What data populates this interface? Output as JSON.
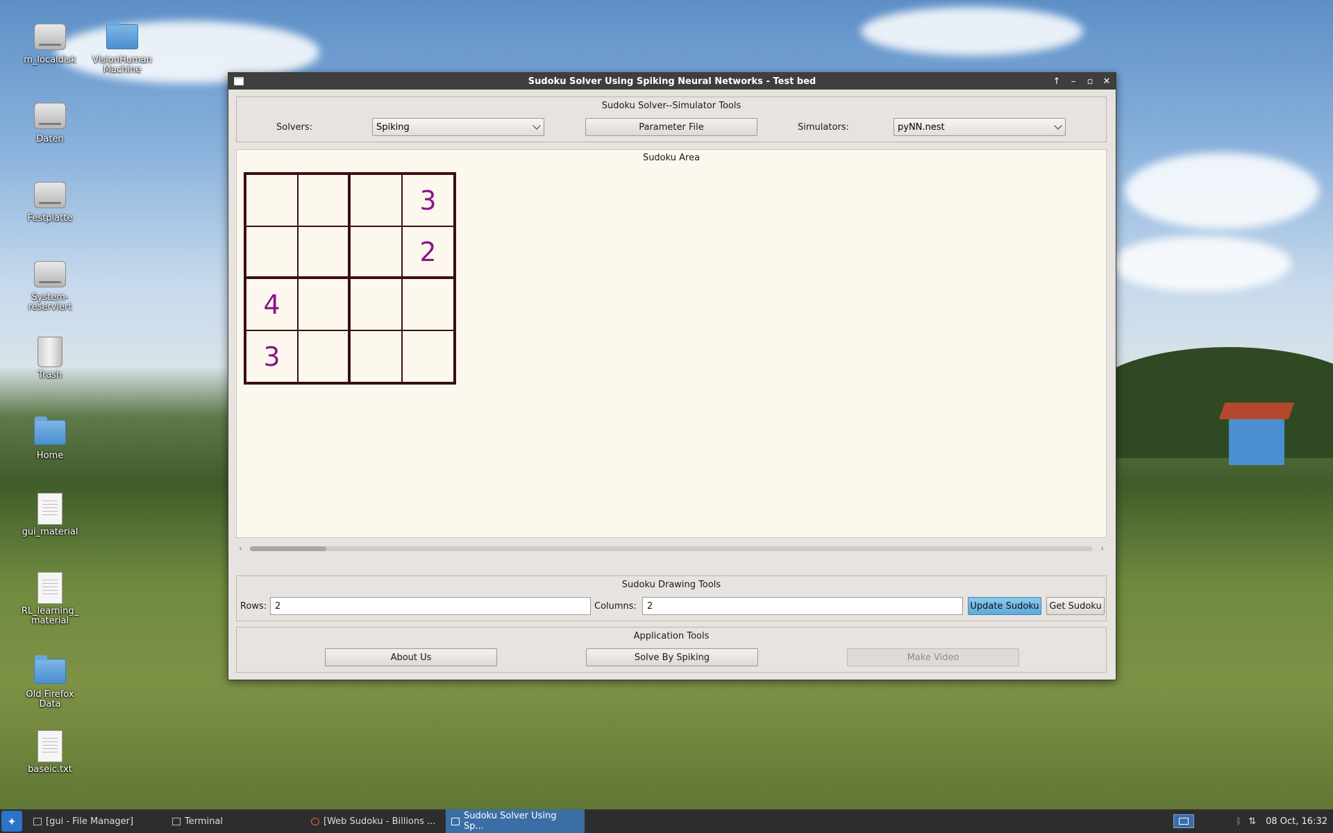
{
  "desktop": {
    "icons": [
      {
        "label": "m_localdisk",
        "icon": "drive-icon"
      },
      {
        "label": "VisionHuman\nMachine",
        "icon": "locked-folder-icon"
      },
      {
        "label": "Daten",
        "icon": "drive-icon"
      },
      {
        "label": "Festplatte",
        "icon": "drive-icon"
      },
      {
        "label": "System-\nreserviert",
        "icon": "drive-icon"
      },
      {
        "label": "Trash",
        "icon": "trash-icon"
      },
      {
        "label": "Home",
        "icon": "home-folder-icon"
      },
      {
        "label": "gui_material",
        "icon": "document-icon"
      },
      {
        "label": "RL_learning_\nmaterial",
        "icon": "document-icon"
      },
      {
        "label": "Old Firefox\nData",
        "icon": "folder-icon"
      },
      {
        "label": "baseic.txt",
        "icon": "document-icon"
      }
    ]
  },
  "window": {
    "title": "Sudoku Solver Using Spiking Neural Networks - Test bed",
    "controls": [
      "↑",
      "–",
      "▫",
      "✕"
    ],
    "simulator_tools": {
      "title": "Sudoku Solver--Simulator Tools",
      "solvers_label": "Solvers:",
      "solver_value": "Spiking",
      "parameter_button": "Parameter File",
      "simulators_label": "Simulators:",
      "simulator_value": "pyNN.nest"
    },
    "sudoku_area": {
      "title": "Sudoku Area",
      "grid": [
        [
          "",
          "",
          "",
          "3"
        ],
        [
          "",
          "",
          "",
          "2"
        ],
        [
          "4",
          "",
          "",
          ""
        ],
        [
          "3",
          "",
          "",
          ""
        ]
      ]
    },
    "drawing_tools": {
      "title": "Sudoku Drawing Tools",
      "rows_label": "Rows:",
      "rows_value": "2",
      "columns_label": "Columns:",
      "columns_value": "2",
      "update_button": "Update Sudoku",
      "get_button": "Get Sudoku"
    },
    "application_tools": {
      "title": "Application Tools",
      "about_button": "About Us",
      "solve_button": "Solve By Spiking",
      "video_button": "Make Video"
    }
  },
  "taskbar": {
    "tasks": [
      {
        "label": "[gui - File Manager]"
      },
      {
        "label": "Terminal"
      },
      {
        "label": "[Web Sudoku - Billions ..."
      },
      {
        "label": "Sudoku Solver Using Sp..."
      }
    ],
    "clock": "08 Oct, 16:32"
  },
  "colors": {
    "digit": "#8a148a",
    "grid_line": "#3a0f12",
    "primary_button": "#5fa9da",
    "taskbar_active": "#3b6ea5"
  }
}
